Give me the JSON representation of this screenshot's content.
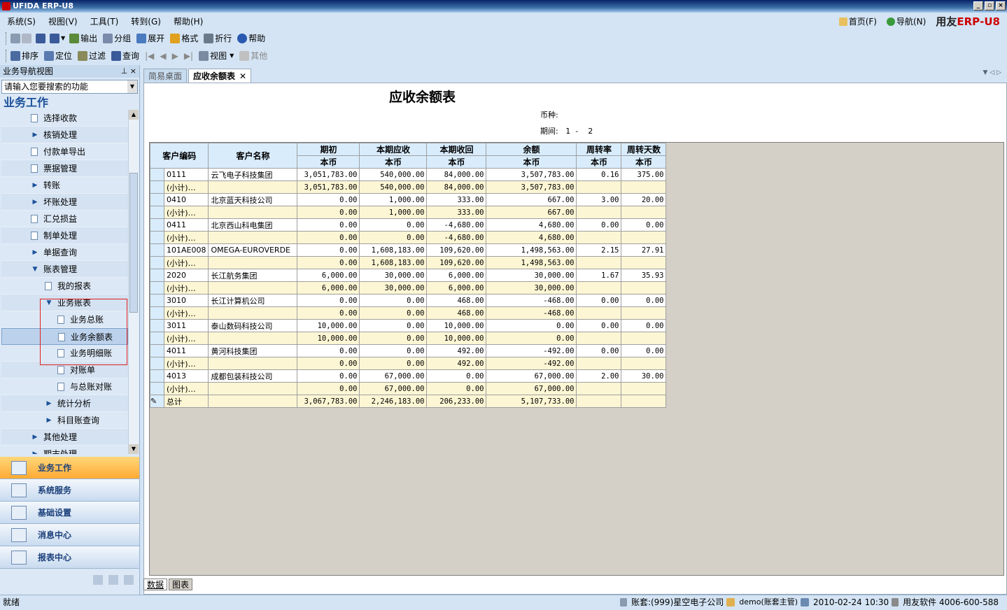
{
  "window": {
    "title": "UFIDA ERP-U8"
  },
  "menu": [
    "系统(S)",
    "视图(V)",
    "工具(T)",
    "转到(G)",
    "帮助(H)"
  ],
  "topnav": {
    "home": "首页(F)",
    "nav": "导航(N)",
    "brand_prefix": "用友",
    "brand_erp": "ERP",
    "brand_suffix": "-U8"
  },
  "toolbar1": [
    "输出",
    "分组",
    "展开",
    "格式",
    "折行",
    "帮助"
  ],
  "toolbar2": [
    "排序",
    "定位",
    "过滤",
    "查询",
    "视图",
    "其他"
  ],
  "leftpanel": {
    "title": "业务导航视图",
    "search_placeholder": "请输入您要搜索的功能",
    "section": "业务工作",
    "tree": [
      {
        "label": "选择收款",
        "level": 1,
        "type": "doc"
      },
      {
        "label": "核销处理",
        "level": 1,
        "type": "folder"
      },
      {
        "label": "付款单导出",
        "level": 1,
        "type": "doc"
      },
      {
        "label": "票据管理",
        "level": 1,
        "type": "doc"
      },
      {
        "label": "转账",
        "level": 1,
        "type": "folder"
      },
      {
        "label": "坏账处理",
        "level": 1,
        "type": "folder"
      },
      {
        "label": "汇兑损益",
        "level": 1,
        "type": "doc"
      },
      {
        "label": "制单处理",
        "level": 1,
        "type": "doc"
      },
      {
        "label": "单据查询",
        "level": 1,
        "type": "folder"
      },
      {
        "label": "账表管理",
        "level": 1,
        "type": "open"
      },
      {
        "label": "我的报表",
        "level": 2,
        "type": "doc"
      },
      {
        "label": "业务账表",
        "level": 2,
        "type": "open"
      },
      {
        "label": "业务总账",
        "level": 3,
        "type": "doc"
      },
      {
        "label": "业务余额表",
        "level": 3,
        "type": "doc",
        "selected": true
      },
      {
        "label": "业务明细账",
        "level": 3,
        "type": "doc"
      },
      {
        "label": "对账单",
        "level": 3,
        "type": "doc"
      },
      {
        "label": "与总账对账",
        "level": 3,
        "type": "doc"
      },
      {
        "label": "统计分析",
        "level": 2,
        "type": "folder"
      },
      {
        "label": "科目账查询",
        "level": 2,
        "type": "folder"
      },
      {
        "label": "其他处理",
        "level": 1,
        "type": "folder"
      },
      {
        "label": "期末处理",
        "level": 1,
        "type": "folder"
      }
    ],
    "nav_buttons": [
      "业务工作",
      "系统服务",
      "基础设置",
      "消息中心",
      "报表中心"
    ]
  },
  "tabs": [
    {
      "label": "简易桌面"
    },
    {
      "label": "应收余额表",
      "active": true
    }
  ],
  "report": {
    "title": "应收余额表",
    "currency_label": "币种:",
    "currency_value": "",
    "period_label": "期间:",
    "period_from": "1",
    "period_sep": "-",
    "period_to": "2",
    "headers": {
      "code": "客户编码",
      "name": "客户名称",
      "opening": "期初",
      "receivable": "本期应收",
      "received": "本期收回",
      "balance": "余额",
      "turnover": "周转率",
      "days": "周转天数",
      "currency": "本币"
    },
    "rows": [
      {
        "code": "0111",
        "name": "云飞电子科技集团",
        "opening": "3,051,783.00",
        "receivable": "540,000.00",
        "received": "84,000.00",
        "balance": "3,507,783.00",
        "turnover": "0.16",
        "days": "375.00"
      },
      {
        "code": "(小计)…",
        "name": "",
        "opening": "3,051,783.00",
        "receivable": "540,000.00",
        "received": "84,000.00",
        "balance": "3,507,783.00",
        "turnover": "",
        "days": "",
        "sub": true
      },
      {
        "code": "0410",
        "name": "北京蓝天科技公司",
        "opening": "0.00",
        "receivable": "1,000.00",
        "received": "333.00",
        "balance": "667.00",
        "turnover": "3.00",
        "days": "20.00"
      },
      {
        "code": "(小计)…",
        "name": "",
        "opening": "0.00",
        "receivable": "1,000.00",
        "received": "333.00",
        "balance": "667.00",
        "turnover": "",
        "days": "",
        "sub": true
      },
      {
        "code": "0411",
        "name": "北京西山科电集团",
        "opening": "0.00",
        "receivable": "0.00",
        "received": "-4,680.00",
        "balance": "4,680.00",
        "turnover": "0.00",
        "days": "0.00"
      },
      {
        "code": "(小计)…",
        "name": "",
        "opening": "0.00",
        "receivable": "0.00",
        "received": "-4,680.00",
        "balance": "4,680.00",
        "turnover": "",
        "days": "",
        "sub": true
      },
      {
        "code": "101AE008",
        "name": "OMEGA-EUROVERDE",
        "opening": "0.00",
        "receivable": "1,608,183.00",
        "received": "109,620.00",
        "balance": "1,498,563.00",
        "turnover": "2.15",
        "days": "27.91"
      },
      {
        "code": "(小计)…",
        "name": "",
        "opening": "0.00",
        "receivable": "1,608,183.00",
        "received": "109,620.00",
        "balance": "1,498,563.00",
        "turnover": "",
        "days": "",
        "sub": true
      },
      {
        "code": "2020",
        "name": "长江航务集团",
        "opening": "6,000.00",
        "receivable": "30,000.00",
        "received": "6,000.00",
        "balance": "30,000.00",
        "turnover": "1.67",
        "days": "35.93"
      },
      {
        "code": "(小计)…",
        "name": "",
        "opening": "6,000.00",
        "receivable": "30,000.00",
        "received": "6,000.00",
        "balance": "30,000.00",
        "turnover": "",
        "days": "",
        "sub": true
      },
      {
        "code": "3010",
        "name": "长江计算机公司",
        "opening": "0.00",
        "receivable": "0.00",
        "received": "468.00",
        "balance": "-468.00",
        "turnover": "0.00",
        "days": "0.00"
      },
      {
        "code": "(小计)…",
        "name": "",
        "opening": "0.00",
        "receivable": "0.00",
        "received": "468.00",
        "balance": "-468.00",
        "turnover": "",
        "days": "",
        "sub": true
      },
      {
        "code": "3011",
        "name": "泰山数码科技公司",
        "opening": "10,000.00",
        "receivable": "0.00",
        "received": "10,000.00",
        "balance": "0.00",
        "turnover": "0.00",
        "days": "0.00"
      },
      {
        "code": "(小计)…",
        "name": "",
        "opening": "10,000.00",
        "receivable": "0.00",
        "received": "10,000.00",
        "balance": "0.00",
        "turnover": "",
        "days": "",
        "sub": true
      },
      {
        "code": "4011",
        "name": "黄河科技集团",
        "opening": "0.00",
        "receivable": "0.00",
        "received": "492.00",
        "balance": "-492.00",
        "turnover": "0.00",
        "days": "0.00"
      },
      {
        "code": "(小计)…",
        "name": "",
        "opening": "0.00",
        "receivable": "0.00",
        "received": "492.00",
        "balance": "-492.00",
        "turnover": "",
        "days": "",
        "sub": true
      },
      {
        "code": "4013",
        "name": "成都包装科技公司",
        "opening": "0.00",
        "receivable": "67,000.00",
        "received": "0.00",
        "balance": "67,000.00",
        "turnover": "2.00",
        "days": "30.00"
      },
      {
        "code": "(小计)…",
        "name": "",
        "opening": "0.00",
        "receivable": "67,000.00",
        "received": "0.00",
        "balance": "67,000.00",
        "turnover": "",
        "days": "",
        "sub": true
      },
      {
        "code": "总计",
        "name": "",
        "opening": "3,067,783.00",
        "receivable": "2,246,183.00",
        "received": "206,233.00",
        "balance": "5,107,733.00",
        "turnover": "",
        "days": "",
        "total": true
      }
    ]
  },
  "bottomtabs": [
    "数据",
    "图表"
  ],
  "status": {
    "left": "就绪",
    "account": "账套:(999)星空电子公司",
    "user": "demo(账套主管)",
    "datetime": "2010-02-24 10:30",
    "phone": "用友软件 4006-600-588"
  }
}
